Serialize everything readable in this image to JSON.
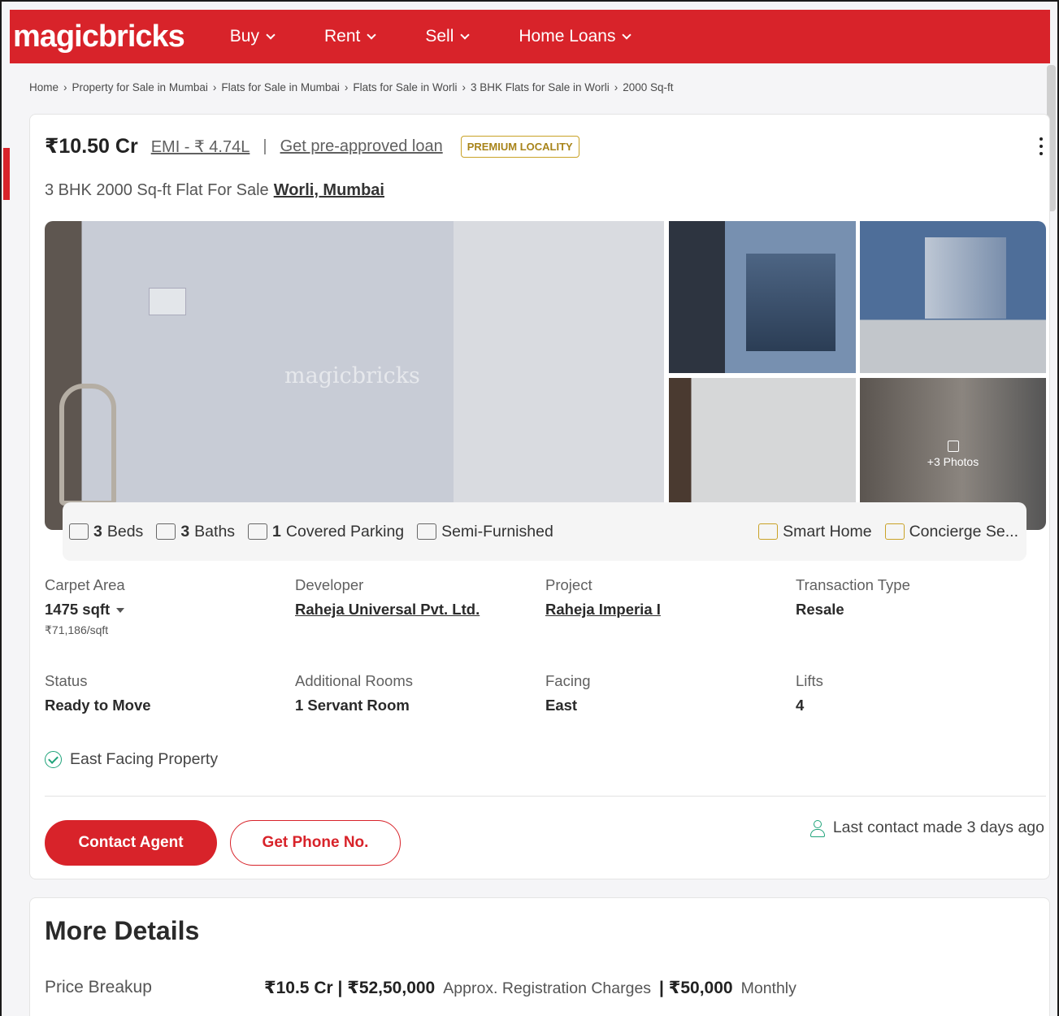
{
  "header": {
    "logo": "magicbricks",
    "nav": [
      {
        "label": "Buy"
      },
      {
        "label": "Rent"
      },
      {
        "label": "Sell"
      },
      {
        "label": "Home Loans"
      }
    ],
    "brand_color": "#d8232a"
  },
  "breadcrumb": [
    "Home",
    "Property for Sale in Mumbai",
    "Flats for Sale in Mumbai",
    "Flats for Sale in Worli",
    "3 BHK Flats for Sale in Worli",
    "2000 Sq-ft"
  ],
  "listing": {
    "price": "₹10.50 Cr",
    "emi": "EMI - ₹ 4.74L",
    "separator": "|",
    "loan_link": "Get pre-approved loan",
    "badge": "PREMIUM LOCALITY",
    "title_prefix": "3 BHK 2000 Sq-ft Flat For Sale",
    "location": "Worli, Mumbai"
  },
  "gallery": {
    "watermark": "magicbricks",
    "more_photos": "+3 Photos"
  },
  "amenities": {
    "beds_count": "3",
    "beds_label": "Beds",
    "baths_count": "3",
    "baths_label": "Baths",
    "parking_count": "1",
    "parking_label": "Covered Parking",
    "furnishing": "Semi-Furnished",
    "smart_home": "Smart Home",
    "concierge": "Concierge Se..."
  },
  "specs": {
    "carpet_area": {
      "label": "Carpet Area",
      "value": "1475 sqft",
      "sub": "₹71,186/sqft"
    },
    "developer": {
      "label": "Developer",
      "value": "Raheja Universal Pvt. Ltd."
    },
    "project": {
      "label": "Project",
      "value": "Raheja Imperia I"
    },
    "transaction": {
      "label": "Transaction Type",
      "value": "Resale"
    },
    "status": {
      "label": "Status",
      "value": "Ready to Move"
    },
    "additional_rooms": {
      "label": "Additional Rooms",
      "value": "1 Servant Room"
    },
    "facing": {
      "label": "Facing",
      "value": "East"
    },
    "lifts": {
      "label": "Lifts",
      "value": "4"
    }
  },
  "highlight": "East Facing Property",
  "actions": {
    "contact_agent": "Contact Agent",
    "get_phone": "Get Phone No.",
    "last_contact": "Last contact made 3 days ago"
  },
  "more_details": {
    "title": "More Details",
    "price_breakup_label": "Price Breakup",
    "price_breakup_value": "₹10.5 Cr | ₹52,50,000",
    "registration_label": "Approx. Registration Charges",
    "monthly_value": "| ₹50,000",
    "monthly_label": "Monthly"
  }
}
